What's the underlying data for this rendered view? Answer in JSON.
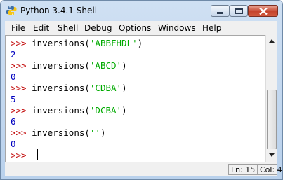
{
  "window": {
    "title": "Python 3.4.1 Shell",
    "icon": "python-icon",
    "accent": "#b9d1ec"
  },
  "menubar": {
    "items": [
      {
        "label": "File"
      },
      {
        "label": "Edit"
      },
      {
        "label": "Shell"
      },
      {
        "label": "Debug"
      },
      {
        "label": "Options"
      },
      {
        "label": "Windows"
      },
      {
        "label": "Help"
      }
    ]
  },
  "shell": {
    "prompt": ">>>",
    "entries": [
      {
        "call": "inversions(",
        "arg": "'ABBFHDL'",
        "close": ")",
        "result": "2"
      },
      {
        "call": "inversions(",
        "arg": "'ABCD'",
        "close": ")",
        "result": "0"
      },
      {
        "call": "inversions(",
        "arg": "'CDBA'",
        "close": ")",
        "result": "5"
      },
      {
        "call": "inversions(",
        "arg": "'DCBA'",
        "close": ")",
        "result": "6"
      },
      {
        "call": "inversions(",
        "arg": "''",
        "close": ")",
        "result": "0"
      }
    ],
    "colors": {
      "prompt": "#c00000",
      "string": "#00aa00",
      "output": "#0000c0"
    }
  },
  "status": {
    "line": "Ln: 15",
    "col": "Col: 4"
  }
}
